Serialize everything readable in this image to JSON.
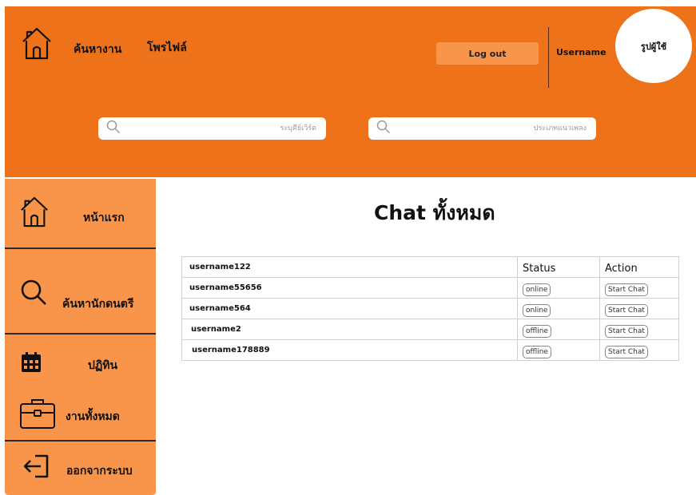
{
  "header": {
    "nav": [
      {
        "label": "ค้นหางาน"
      },
      {
        "label": "โพรไฟล์"
      }
    ],
    "logout_label": "Log out",
    "username": "Username",
    "avatar_label": "รูปผู้ใช้",
    "search": {
      "keyword_placeholder": "ระบุคีย์เวิร์ด",
      "genre_placeholder": "ประเภทแนวเพลง"
    }
  },
  "sidebar": {
    "items": [
      {
        "label": "หน้าแรก"
      },
      {
        "label": "ค้นหานักดนตรี"
      },
      {
        "label": "ปฏิทิน"
      },
      {
        "label": "งานทั้งหมด"
      },
      {
        "label": "ออกจากระบบ"
      }
    ]
  },
  "main": {
    "title": "Chat ทั้งหมด",
    "table": {
      "status_header": "Status",
      "action_header": "Action",
      "first_user": "username122",
      "rows": [
        {
          "user": "username55656",
          "status": "online",
          "action": "Start Chat"
        },
        {
          "user": "username564",
          "status": "online",
          "action": "Start Chat"
        },
        {
          "user": "username2",
          "status": "offline",
          "action": "Start Chat"
        },
        {
          "user": "username178889",
          "status": "offline",
          "action": "Start Chat"
        }
      ]
    }
  },
  "colors": {
    "header_bg": "#ee7219",
    "sidebar_bg": "#f9954a",
    "button_bg": "#f9954a"
  },
  "icons": {
    "header_home": "home-icon",
    "search": "search-icon",
    "sidebar": [
      "home-icon",
      "search-icon",
      "calendar-icon",
      "briefcase-icon",
      "logout-icon"
    ]
  }
}
